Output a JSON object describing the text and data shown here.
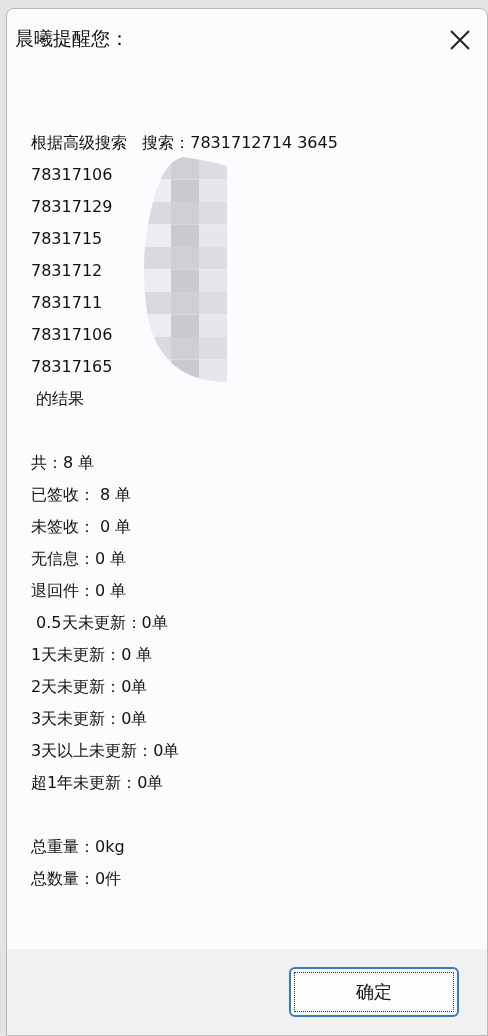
{
  "dialog": {
    "title": "晨曦提醒您：",
    "search_lines": [
      "根据高级搜索   搜索：7831712714 3645",
      "78317106",
      "78317129",
      "7831715",
      "7831712",
      "7831711",
      "78317106",
      "78317165",
      " 的结果"
    ],
    "count_lines": [
      "共：8 单",
      "已签收： 8 单",
      "未签收： 0 单",
      "无信息：0 单",
      "退回件：0 单",
      " 0.5天未更新：0单",
      "1天未更新：0 单",
      "2天未更新：0单",
      "3天未更新：0单",
      "3天以上未更新：0单",
      "超1年未更新：0单"
    ],
    "total_lines": [
      "总重量：0kg",
      "总数量：0件"
    ],
    "ok_button": "确定"
  }
}
